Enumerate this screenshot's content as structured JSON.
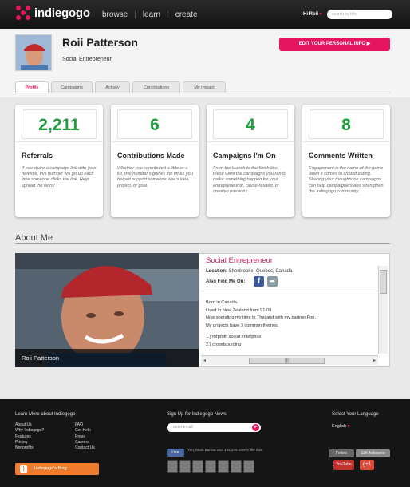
{
  "header": {
    "logo": "indiegogo",
    "nav": [
      "browse",
      "learn",
      "create"
    ],
    "greeting": "Hi Roii",
    "search_placeholder": "search by title"
  },
  "profile": {
    "name": "Roii Patterson",
    "role": "Social Entrepreneur",
    "edit_button": "EDIT YOUR PERSONAL INFO ▶",
    "tabs": [
      "Profile",
      "Campaigns",
      "Activity",
      "Contributions",
      "My Impact"
    ]
  },
  "stats": [
    {
      "value": "2,211",
      "label": "Referrals",
      "desc": "If you share a campaign link with your network, this number will go up each time someone clicks the link. Help spread the word!"
    },
    {
      "value": "6",
      "label": "Contributions Made",
      "desc": "Whether you contributed a little or a lot, this number signifies the times you helped support someone else's idea, project, or goal."
    },
    {
      "value": "4",
      "label": "Campaigns I'm On",
      "desc": "From the launch to the finish line, these were the campaigns you ran to make something happen for your entrepreneurial, cause-related, or creative passions."
    },
    {
      "value": "8",
      "label": "Comments Written",
      "desc": "Engagement is the name of the game when it comes to crowdfunding. Sharing your thoughts on campaigns can help campaigners and strengthen the Indiegogo community."
    }
  ],
  "about": {
    "section_title": "About Me",
    "photo_caption": "Roii Patterson",
    "title": "Social Entrepreneur",
    "location_label": "Location:",
    "location": "Sherbrooke, Quebec, Canada",
    "find_me": "Also Find Me On:",
    "bio": [
      "Born in Canada.",
      "Lived in New Zealand from 91-09",
      "Now spending my time in Thailand with my partner Fon.",
      "My projects have 3 common themes.",
      "",
      "1.) forprofit social enterprise",
      "2.) crowdsourcing"
    ]
  },
  "footer": {
    "learn_title": "Learn More about Indiegogo",
    "col1": [
      "About Us",
      "Why Indiegogo?",
      "Features",
      "Pricing",
      "Nonprofits"
    ],
    "col2": [
      "FAQ",
      "Get Help",
      "Press",
      "Careers",
      "Contact Us"
    ],
    "blog": "Indiegogo's Blog",
    "news_title": "Sign Up for Indiegogo News",
    "email_placeholder": "enter email",
    "like": "Like",
    "like_text": "You, Mark Barlow and 192,345 others like this.",
    "language_title": "Select Your Language",
    "language": "English",
    "follow": "Follow",
    "followers": "13K followers",
    "youtube": "YouTube",
    "gplus": "g+1"
  }
}
